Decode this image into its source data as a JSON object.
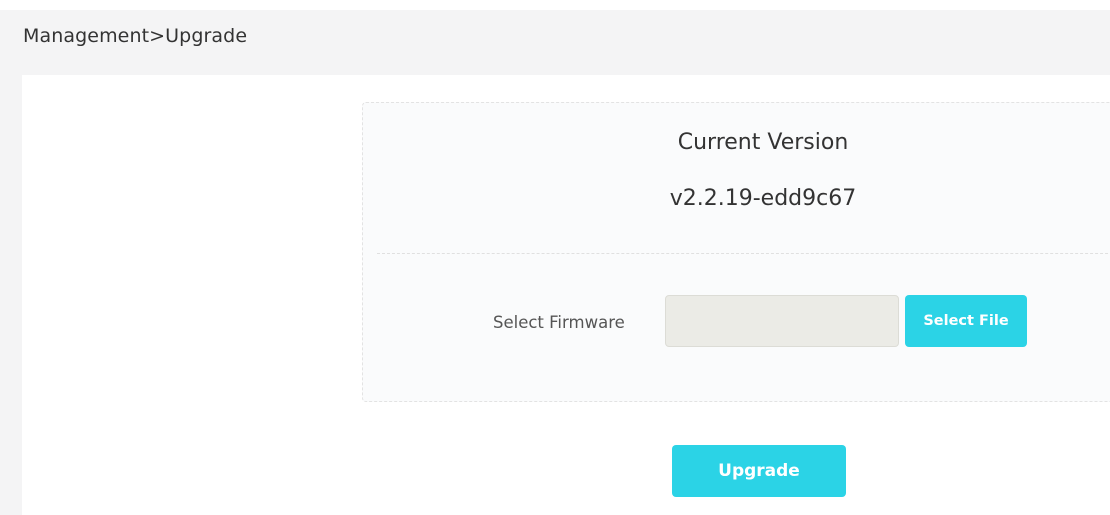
{
  "breadcrumb": {
    "text": "Management>Upgrade"
  },
  "version": {
    "title": "Current Version",
    "value": "v2.2.19-edd9c67"
  },
  "firmware": {
    "label": "Select Firmware",
    "input_value": "",
    "select_button_label": "Select File"
  },
  "actions": {
    "upgrade_label": "Upgrade"
  },
  "colors": {
    "accent": "#2bd3e6",
    "background": "#f4f4f5",
    "card": "#fafbfc",
    "input": "#ebebe6"
  }
}
